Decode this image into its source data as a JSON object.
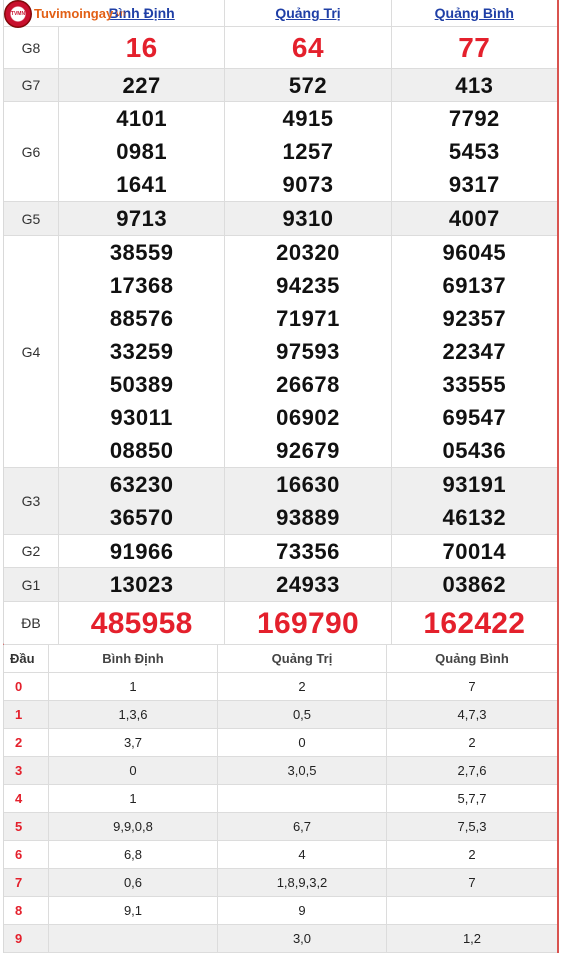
{
  "logo": {
    "name": "Tuvimoingay",
    "tld": ".vn",
    "badge": "TVMN"
  },
  "provinces": [
    "Bình Định",
    "Quảng Trị",
    "Quảng Bình"
  ],
  "prizes": [
    {
      "label": "G8",
      "values": [
        [
          "16"
        ],
        [
          "64"
        ],
        [
          "77"
        ]
      ]
    },
    {
      "label": "G7",
      "values": [
        [
          "227"
        ],
        [
          "572"
        ],
        [
          "413"
        ]
      ]
    },
    {
      "label": "G6",
      "values": [
        [
          "4101",
          "0981",
          "1641"
        ],
        [
          "4915",
          "1257",
          "9073"
        ],
        [
          "7792",
          "5453",
          "9317"
        ]
      ]
    },
    {
      "label": "G5",
      "values": [
        [
          "9713"
        ],
        [
          "9310"
        ],
        [
          "4007"
        ]
      ]
    },
    {
      "label": "G4",
      "values": [
        [
          "38559",
          "17368",
          "88576",
          "33259",
          "50389",
          "93011",
          "08850"
        ],
        [
          "20320",
          "94235",
          "71971",
          "97593",
          "26678",
          "06902",
          "92679"
        ],
        [
          "96045",
          "69137",
          "92357",
          "22347",
          "33555",
          "69547",
          "05436"
        ]
      ]
    },
    {
      "label": "G3",
      "values": [
        [
          "63230",
          "36570"
        ],
        [
          "16630",
          "93889"
        ],
        [
          "93191",
          "46132"
        ]
      ]
    },
    {
      "label": "G2",
      "values": [
        [
          "91966"
        ],
        [
          "73356"
        ],
        [
          "70014"
        ]
      ]
    },
    {
      "label": "G1",
      "values": [
        [
          "13023"
        ],
        [
          "24933"
        ],
        [
          "03862"
        ]
      ]
    },
    {
      "label": "ĐB",
      "values": [
        [
          "485958"
        ],
        [
          "169790"
        ],
        [
          "162422"
        ]
      ]
    }
  ],
  "loto": {
    "header": "Đầu",
    "rows": [
      {
        "dau": "0",
        "cols": [
          "1",
          "2",
          "7"
        ]
      },
      {
        "dau": "1",
        "cols": [
          "1,3,6",
          "0,5",
          "4,7,3"
        ]
      },
      {
        "dau": "2",
        "cols": [
          "3,7",
          "0",
          "2"
        ]
      },
      {
        "dau": "3",
        "cols": [
          "0",
          "3,0,5",
          "2,7,6"
        ]
      },
      {
        "dau": "4",
        "cols": [
          "1",
          "",
          "5,7,7"
        ]
      },
      {
        "dau": "5",
        "cols": [
          "9,9,0,8",
          "6,7",
          "7,5,3"
        ]
      },
      {
        "dau": "6",
        "cols": [
          "6,8",
          "4",
          "2"
        ]
      },
      {
        "dau": "7",
        "cols": [
          "0,6",
          "1,8,9,3,2",
          "7"
        ]
      },
      {
        "dau": "8",
        "cols": [
          "9,1",
          "9",
          ""
        ]
      },
      {
        "dau": "9",
        "cols": [
          "",
          "3,0",
          "1,2"
        ]
      }
    ]
  },
  "colors": {
    "accent_red": "#e4202c",
    "link_blue": "#1f3fa6",
    "logo_orange": "#e25f14",
    "row_alt": "#efefef"
  }
}
